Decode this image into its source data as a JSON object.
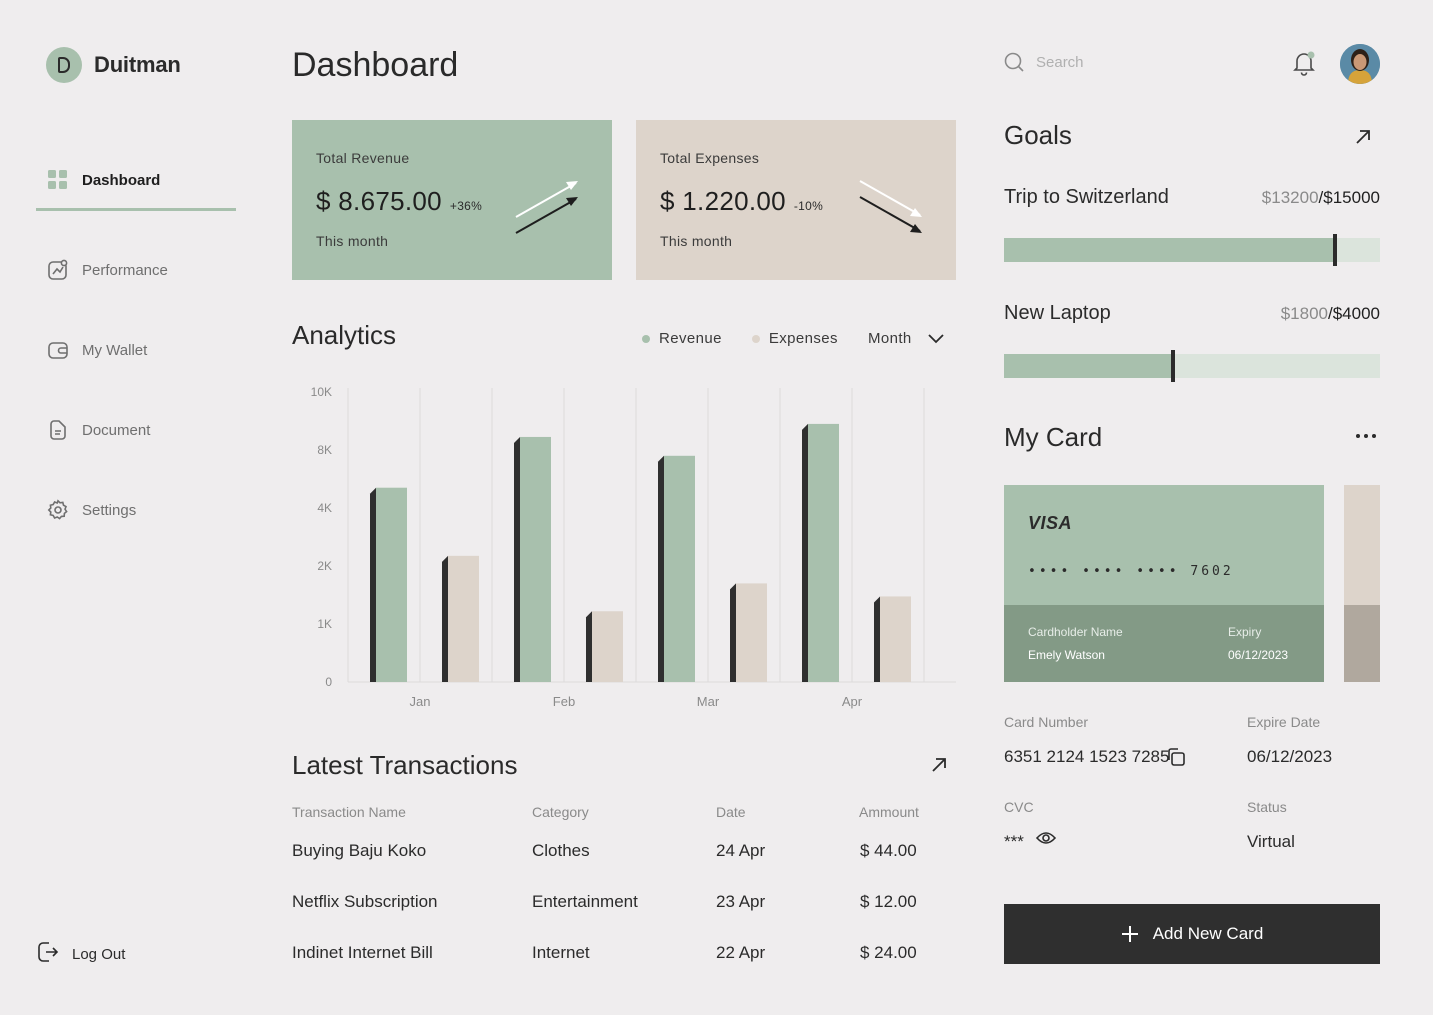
{
  "brand": {
    "logo_letter": "D",
    "name": "Duitman"
  },
  "sidebar": {
    "items": [
      {
        "label": "Dashboard",
        "icon": "grid-icon"
      },
      {
        "label": "Performance",
        "icon": "chart-icon"
      },
      {
        "label": "My Wallet",
        "icon": "wallet-icon"
      },
      {
        "label": "Document",
        "icon": "document-icon"
      },
      {
        "label": "Settings",
        "icon": "gear-icon"
      }
    ],
    "active": "Dashboard",
    "logout_label": "Log Out"
  },
  "header": {
    "title": "Dashboard",
    "search_placeholder": "Search"
  },
  "stats": {
    "revenue": {
      "label": "Total Revenue",
      "value": "$ 8.675.00",
      "change": "+36%",
      "sub": "This month"
    },
    "expenses": {
      "label": "Total Expenses",
      "value": "$ 1.220.00",
      "change": "-10%",
      "sub": "This month"
    }
  },
  "analytics": {
    "title": "Analytics",
    "legend": {
      "revenue": "Revenue",
      "expenses": "Expenses"
    },
    "period": "Month"
  },
  "chart_data": {
    "type": "bar",
    "categories": [
      "Jan",
      "Feb",
      "Mar",
      "Apr"
    ],
    "y_ticks": [
      "0",
      "1K",
      "2K",
      "4K",
      "8K",
      "10K"
    ],
    "tick_values": [
      0,
      1000,
      2000,
      4000,
      8000,
      10000
    ],
    "series": [
      {
        "name": "Revenue",
        "color": "#a8c0ad",
        "values": [
          5400,
          8450,
          7600,
          8900
        ]
      },
      {
        "name": "Expenses",
        "color": "#ddd4cb",
        "values": [
          2350,
          1220,
          1700,
          1475
        ]
      }
    ],
    "grid": true
  },
  "transactions": {
    "title": "Latest Transactions",
    "columns": [
      "Transaction Name",
      "Category",
      "Date",
      "Ammount"
    ],
    "rows": [
      [
        "Buying Baju Koko",
        "Clothes",
        "24 Apr",
        "$ 44.00"
      ],
      [
        "Netflix Subscription",
        "Entertainment",
        "23 Apr",
        "$ 12.00"
      ],
      [
        "Indinet Internet Bill",
        "Internet",
        "22 Apr",
        "$ 24.00"
      ]
    ]
  },
  "goals": {
    "title": "Goals",
    "items": [
      {
        "name": "Trip to Switzerland",
        "current": "$13200",
        "sep": "/",
        "target": "$15000",
        "progress": 0.88
      },
      {
        "name": "New Laptop",
        "current": "$1800",
        "sep": "/",
        "target": "$4000",
        "progress": 0.45
      }
    ]
  },
  "my_card": {
    "title": "My Card",
    "brand": "VISA",
    "masked_number": "•••• •••• •••• 7602",
    "cardholder_label": "Cardholder Name",
    "cardholder": "Emely Watson",
    "expiry_label": "Expiry",
    "expiry": "06/12/2023",
    "card_number_label": "Card Number",
    "card_number": "6351 2124 1523 7285",
    "expire_date_label": "Expire Date",
    "expire_date": "06/12/2023",
    "cvc_label": "CVC",
    "cvc": "***",
    "status_label": "Status",
    "status": "Virtual",
    "add_button": "Add New Card"
  },
  "colors": {
    "accent_green": "#a8c0ad",
    "accent_beige": "#ddd4cb",
    "dark": "#2f2f2f",
    "background": "#efedee"
  }
}
